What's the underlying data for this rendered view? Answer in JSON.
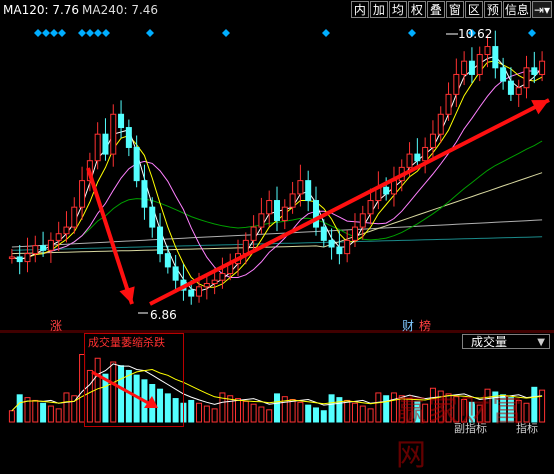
{
  "topbar": {
    "ma120_label": "MA120: 7.76",
    "ma240_label": "MA240: 7.46",
    "buttons": [
      "内",
      "加",
      "均",
      "权",
      "叠",
      "窗",
      "区",
      "预",
      "信息",
      "⇥▾"
    ]
  },
  "price": {
    "high_label": "10.62",
    "low_label": "6.86"
  },
  "markers": {
    "zhang": "涨",
    "caibang": "财",
    "bang": "榜"
  },
  "volume": {
    "selector_label": "成交量",
    "annotation": "成交量萎缩杀跌"
  },
  "watermark": "赢家财富网",
  "footer": {
    "indicator_label": "副指标",
    "tab_label": "指标"
  },
  "colors": {
    "up": "#ff3232",
    "down": "#54ffff",
    "ma5": "#ffffff",
    "ma10": "#ffff00",
    "ma20": "#ff80ff",
    "ma60": "#00c000",
    "arrow": "#ff1010",
    "diamond": "#00aeff"
  },
  "chart_data": {
    "type": "candlestick",
    "series_close": [
      7.45,
      7.38,
      7.5,
      7.62,
      7.55,
      7.7,
      7.8,
      7.9,
      8.2,
      8.6,
      8.9,
      9.3,
      9.0,
      9.6,
      9.4,
      9.1,
      8.6,
      8.2,
      7.9,
      7.5,
      7.3,
      7.1,
      6.95,
      6.86,
      7.0,
      7.05,
      7.1,
      7.2,
      7.35,
      7.5,
      7.7,
      7.9,
      8.1,
      8.3,
      8.0,
      8.2,
      8.4,
      8.6,
      8.3,
      7.9,
      7.7,
      7.6,
      7.5,
      7.7,
      7.9,
      8.1,
      8.3,
      8.5,
      8.4,
      8.6,
      8.8,
      9.0,
      8.9,
      9.1,
      9.3,
      9.6,
      9.9,
      10.2,
      10.4,
      10.2,
      10.5,
      10.62,
      10.3,
      10.1,
      9.9,
      10.0,
      10.3,
      10.2,
      10.4
    ]
  }
}
